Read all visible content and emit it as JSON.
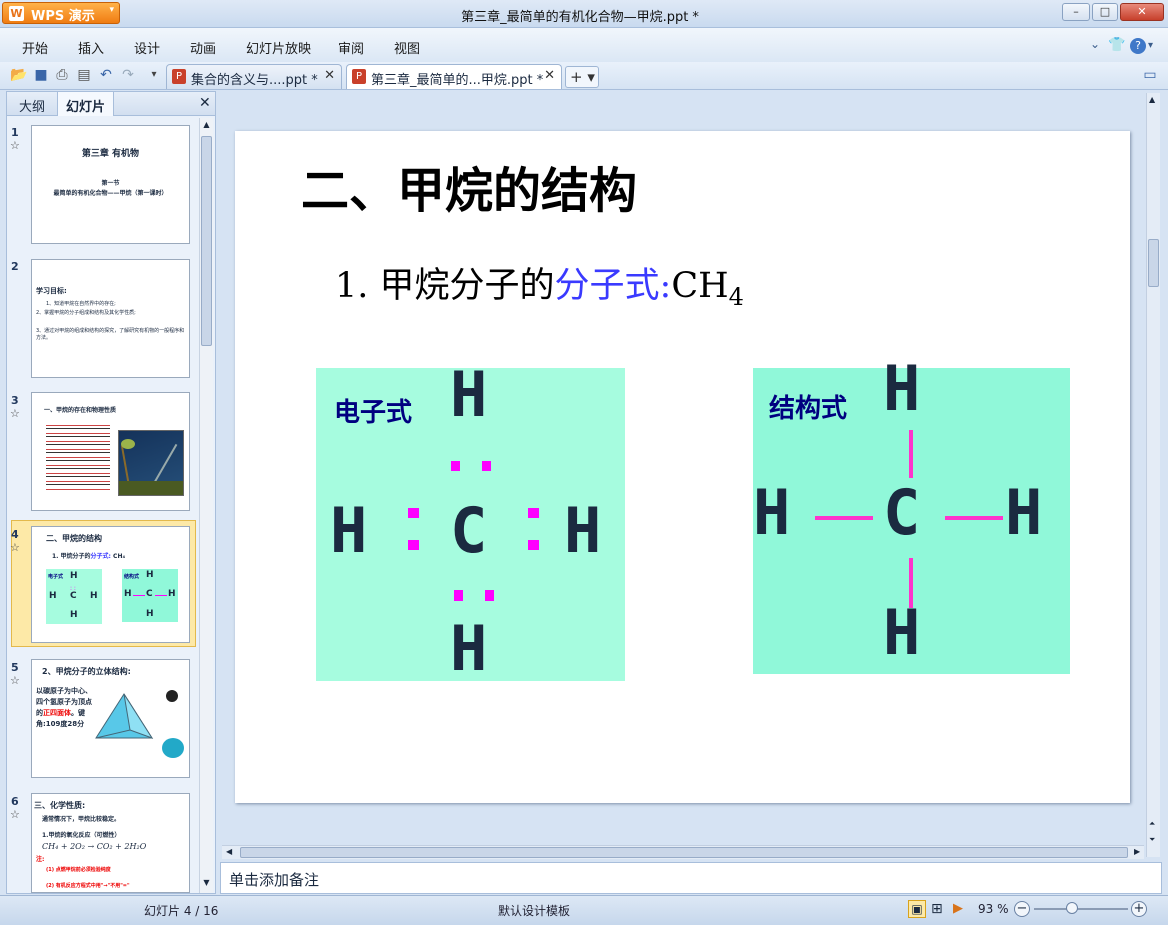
{
  "app": {
    "name": "WPS 演示",
    "window_title": "第三章_最简单的有机化合物—甲烷.ppt *",
    "win_buttons": {
      "min": "–",
      "max": "□",
      "close": "✕"
    }
  },
  "menu": {
    "items": [
      "开始",
      "插入",
      "设计",
      "动画",
      "幻灯片放映",
      "审阅",
      "视图"
    ]
  },
  "tabs": [
    {
      "label": "集合的含义与....ppt *",
      "close": "✕",
      "active": false
    },
    {
      "label": "第三章_最简单的...甲烷.ppt *",
      "close": "✕",
      "active": true
    }
  ],
  "new_tab": "+ ▾",
  "sidebar": {
    "tabs": [
      "大纲",
      "幻灯片"
    ],
    "close": "✕",
    "selected_slide": 4,
    "slides": [
      {
        "num": "1",
        "star": "☆",
        "lines": [
          "第三章 有机物",
          "第一节",
          "最简单的有机化合物——甲烷（第一课时）"
        ]
      },
      {
        "num": "2",
        "star": "",
        "lines": [
          "学习目标:",
          "1、知道甲烷在自然界中的存在;",
          "2、掌握甲烷的分子组成和结构及其化学性质;",
          "3、通过对甲烷的组成和结构的探究，了解研究有机物的一般程序和方法。"
        ]
      },
      {
        "num": "3",
        "star": "☆",
        "lines": [
          "一、甲烷的存在和物理性质"
        ]
      },
      {
        "num": "4",
        "star": "☆",
        "lines": [
          "二、甲烷的结构",
          "1. 甲烷分子的",
          "分子式:",
          "CH₄",
          "电子式",
          "结构式"
        ]
      },
      {
        "num": "5",
        "star": "☆",
        "lines": [
          "2、甲烷分子的立体结构:",
          "以碳原子为中心、四个氢原子为顶点的",
          "正四面体",
          "。键角:109度28分"
        ]
      },
      {
        "num": "6",
        "star": "☆",
        "lines": [
          "三、化学性质:",
          "通常情况下，甲烷比较稳定。",
          "1.甲烷的氧化反应（可燃性）",
          "CH₄ + 2O₂ → CO₂ + 2H₂O",
          "注:",
          "(1) 点燃甲烷前必须检验纯度",
          "(2) 有机反应方程式中用\"→\"不用\"=\""
        ]
      }
    ]
  },
  "slide": {
    "title": "二、甲烷的结构",
    "point_prefix": "1. 甲烷分子的",
    "point_highlight": "分子式:",
    "formula_main": "CH",
    "formula_sub": "4",
    "box1_label": "电子式",
    "box2_label": "结构式",
    "atom_h": "H",
    "atom_c": "C",
    "colors": {
      "box": "#a6fcdf",
      "box2": "#90f8d9",
      "accent": "#3a3aff",
      "dots": "#ff00ff",
      "label": "#000080"
    }
  },
  "notes": {
    "placeholder": "单击添加备注"
  },
  "status": {
    "slide_info": "幻灯片 4 / 16",
    "template": "默认设计模板",
    "zoom": "93 %",
    "zoom_value": 93
  }
}
